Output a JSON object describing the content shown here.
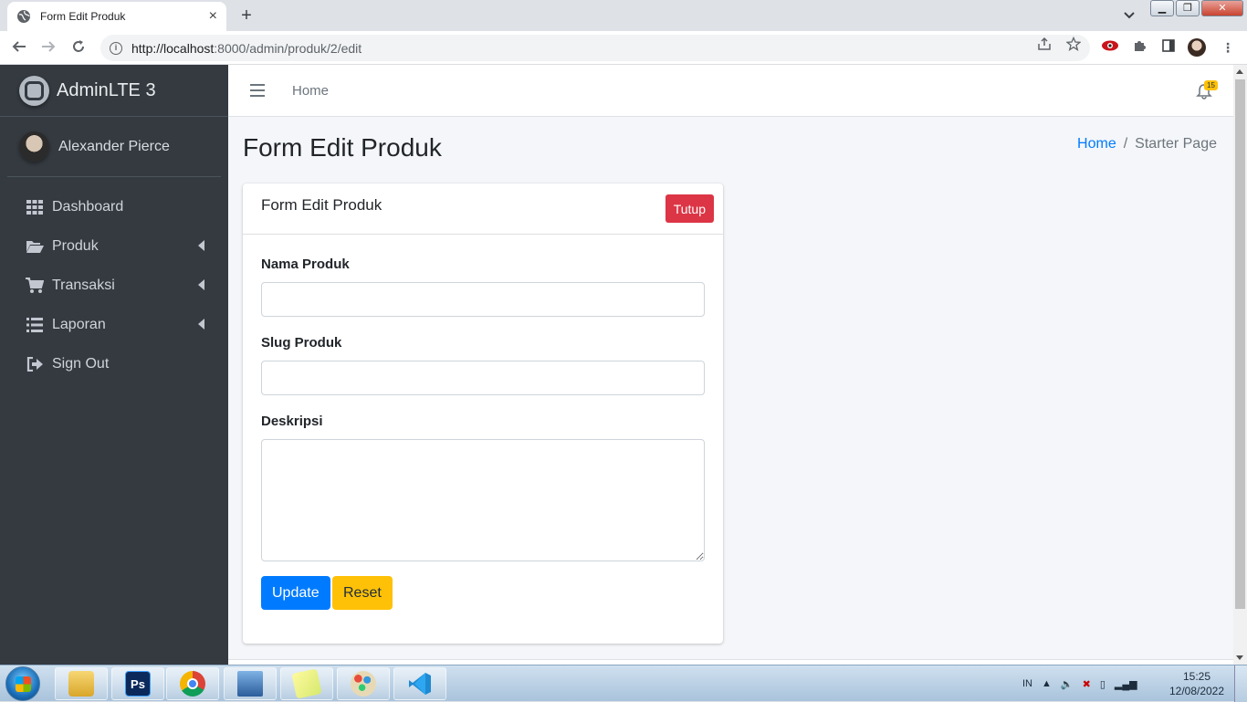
{
  "browser": {
    "tab_title": "Form Edit Produk",
    "tab_close": "×",
    "new_tab": "+",
    "url_host": "http://localhost",
    "url_rest": ":8000/admin/produk/2/edit"
  },
  "sidebar": {
    "brand": "AdminLTE 3",
    "user": "Alexander Pierce",
    "items": [
      {
        "label": "Dashboard",
        "icon": "grid-icon"
      },
      {
        "label": "Produk",
        "icon": "folder-open-icon"
      },
      {
        "label": "Transaksi",
        "icon": "cart-icon"
      },
      {
        "label": "Laporan",
        "icon": "list-icon"
      },
      {
        "label": "Sign Out",
        "icon": "sign-out-icon"
      }
    ]
  },
  "topnav": {
    "home": "Home",
    "notif_count": "15"
  },
  "content": {
    "page_title": "Form Edit Produk",
    "breadcrumb_home": "Home",
    "breadcrumb_sep": "/",
    "breadcrumb_current": "Starter Page"
  },
  "card": {
    "title": "Form Edit Produk",
    "close_label": "Tutup",
    "fields": {
      "nama_label": "Nama Produk",
      "nama_value": "",
      "slug_label": "Slug Produk",
      "slug_value": "",
      "deskripsi_label": "Deskripsi",
      "deskripsi_value": ""
    },
    "update_label": "Update",
    "reset_label": "Reset"
  },
  "taskbar": {
    "apps": [
      "file-explorer-icon",
      "photoshop-icon",
      "chrome-icon",
      "remote-desktop-icon",
      "sticky-notes-icon",
      "paint-icon",
      "vscode-icon"
    ],
    "ps_label": "Ps",
    "lang": "IN",
    "time": "15:25",
    "date": "12/08/2022"
  },
  "colors": {
    "sidebar_bg": "#343a40",
    "primary": "#007bff",
    "danger": "#dc3545",
    "warning": "#ffc107",
    "content_bg": "#f4f6f9"
  }
}
